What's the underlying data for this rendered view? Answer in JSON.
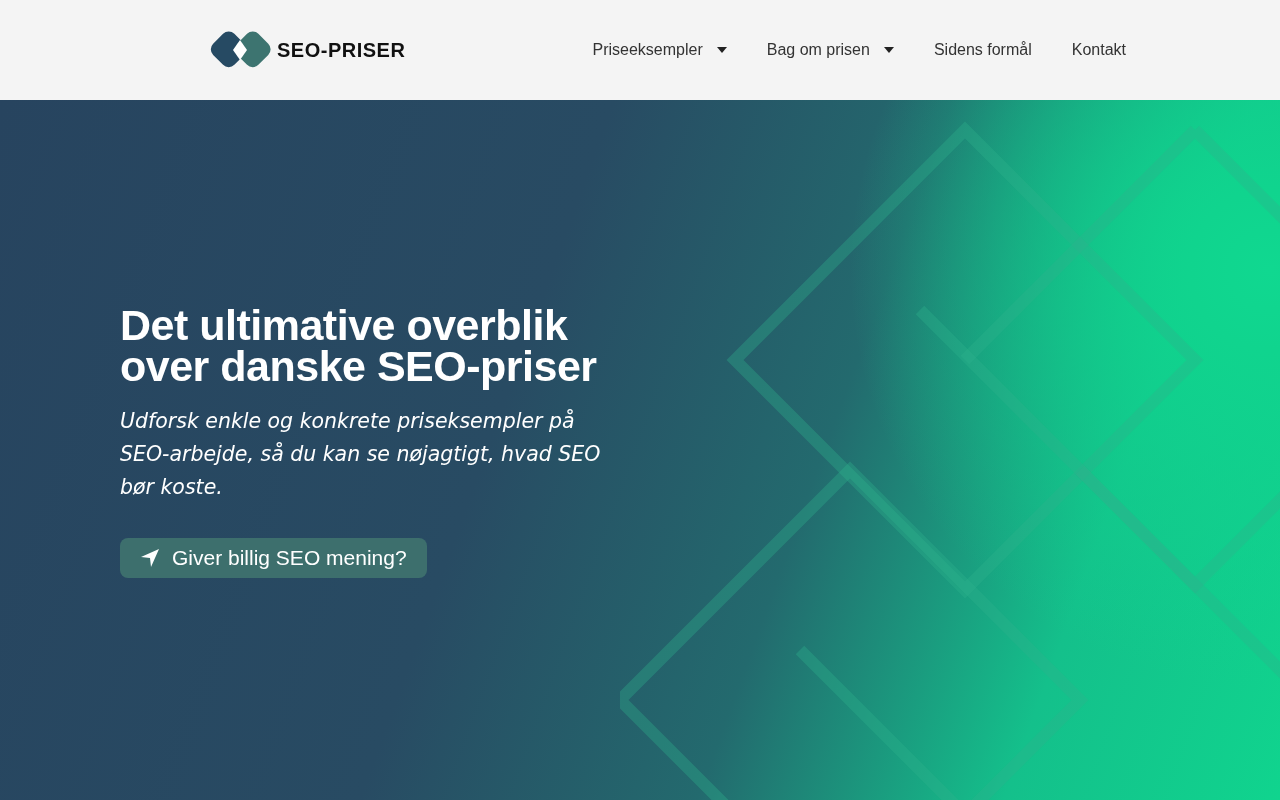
{
  "header": {
    "logo_text": "SEO-PRISER",
    "nav": [
      {
        "label": "Priseeksempler",
        "dropdown": true
      },
      {
        "label": "Bag om prisen",
        "dropdown": true
      },
      {
        "label": "Sidens formål",
        "dropdown": false
      },
      {
        "label": "Kontakt",
        "dropdown": false
      }
    ]
  },
  "hero": {
    "title": "Det ultimative overblik over danske SEO-priser",
    "subtitle": "Udforsk enkle og konkrete priseksempler på SEO-arbejde, så du kan se nøjagtigt, hvad SEO bør koste.",
    "button": "Giver billig SEO mening?"
  }
}
